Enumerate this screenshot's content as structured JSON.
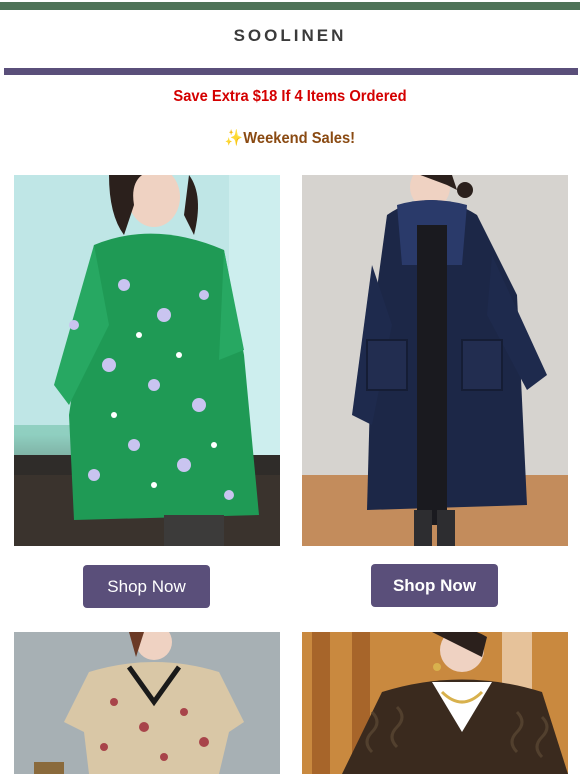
{
  "header": {
    "brand": "SOOLINEN",
    "accent_color": "#4e7358",
    "bar_color": "#5a4f7a"
  },
  "promo": {
    "offer_text": "Save Extra $18 If 4 Items Ordered",
    "offer_color": "#d40000",
    "sparkle": "✨",
    "weekend_text": "Weekend Sales!",
    "weekend_color": "#8a4a12"
  },
  "products": [
    {
      "button_label": "Shop Now",
      "image": "green-floral-chiffon-shirt-dress"
    },
    {
      "button_label": "Shop Now",
      "image": "navy-fleece-hooded-coat"
    },
    {
      "image": "floral-print-v-neck-top"
    },
    {
      "image": "brown-cable-knit-cardigan"
    }
  ]
}
